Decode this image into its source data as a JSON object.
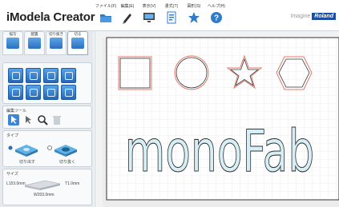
{
  "app": {
    "title": "iModela Creator"
  },
  "menu": [
    {
      "label": "ファイル(F)",
      "icon": "folder-icon"
    },
    {
      "label": "編集(E)",
      "icon": "pencil-icon"
    },
    {
      "label": "表示(V)",
      "icon": "monitor-icon"
    },
    {
      "label": "書式(T)",
      "icon": "document-icon"
    },
    {
      "label": "図形(S)",
      "icon": "star-icon"
    },
    {
      "label": "ヘルプ(H)",
      "icon": "help-icon"
    }
  ],
  "brand": {
    "imagine": "Imagine",
    "roland": "Roland"
  },
  "sidebar": {
    "tabs": [
      "描写",
      "配置",
      "切り抜き",
      "切る"
    ],
    "edit_tools_label": "編集ツール",
    "type_label": "タイプ",
    "type_options": [
      "切り出す",
      "切り抜く"
    ],
    "size_label": "サイズ",
    "size_l": "L153.0mm",
    "size_t": "T1.0mm",
    "size_w": "W203.0mm"
  },
  "canvas": {
    "text": "monoFab"
  },
  "colors": {
    "accent": "#2b6fbd",
    "shape_stroke": "#e07a6a",
    "text_fill": "#d6eef5",
    "grid": "#d8dde3"
  }
}
